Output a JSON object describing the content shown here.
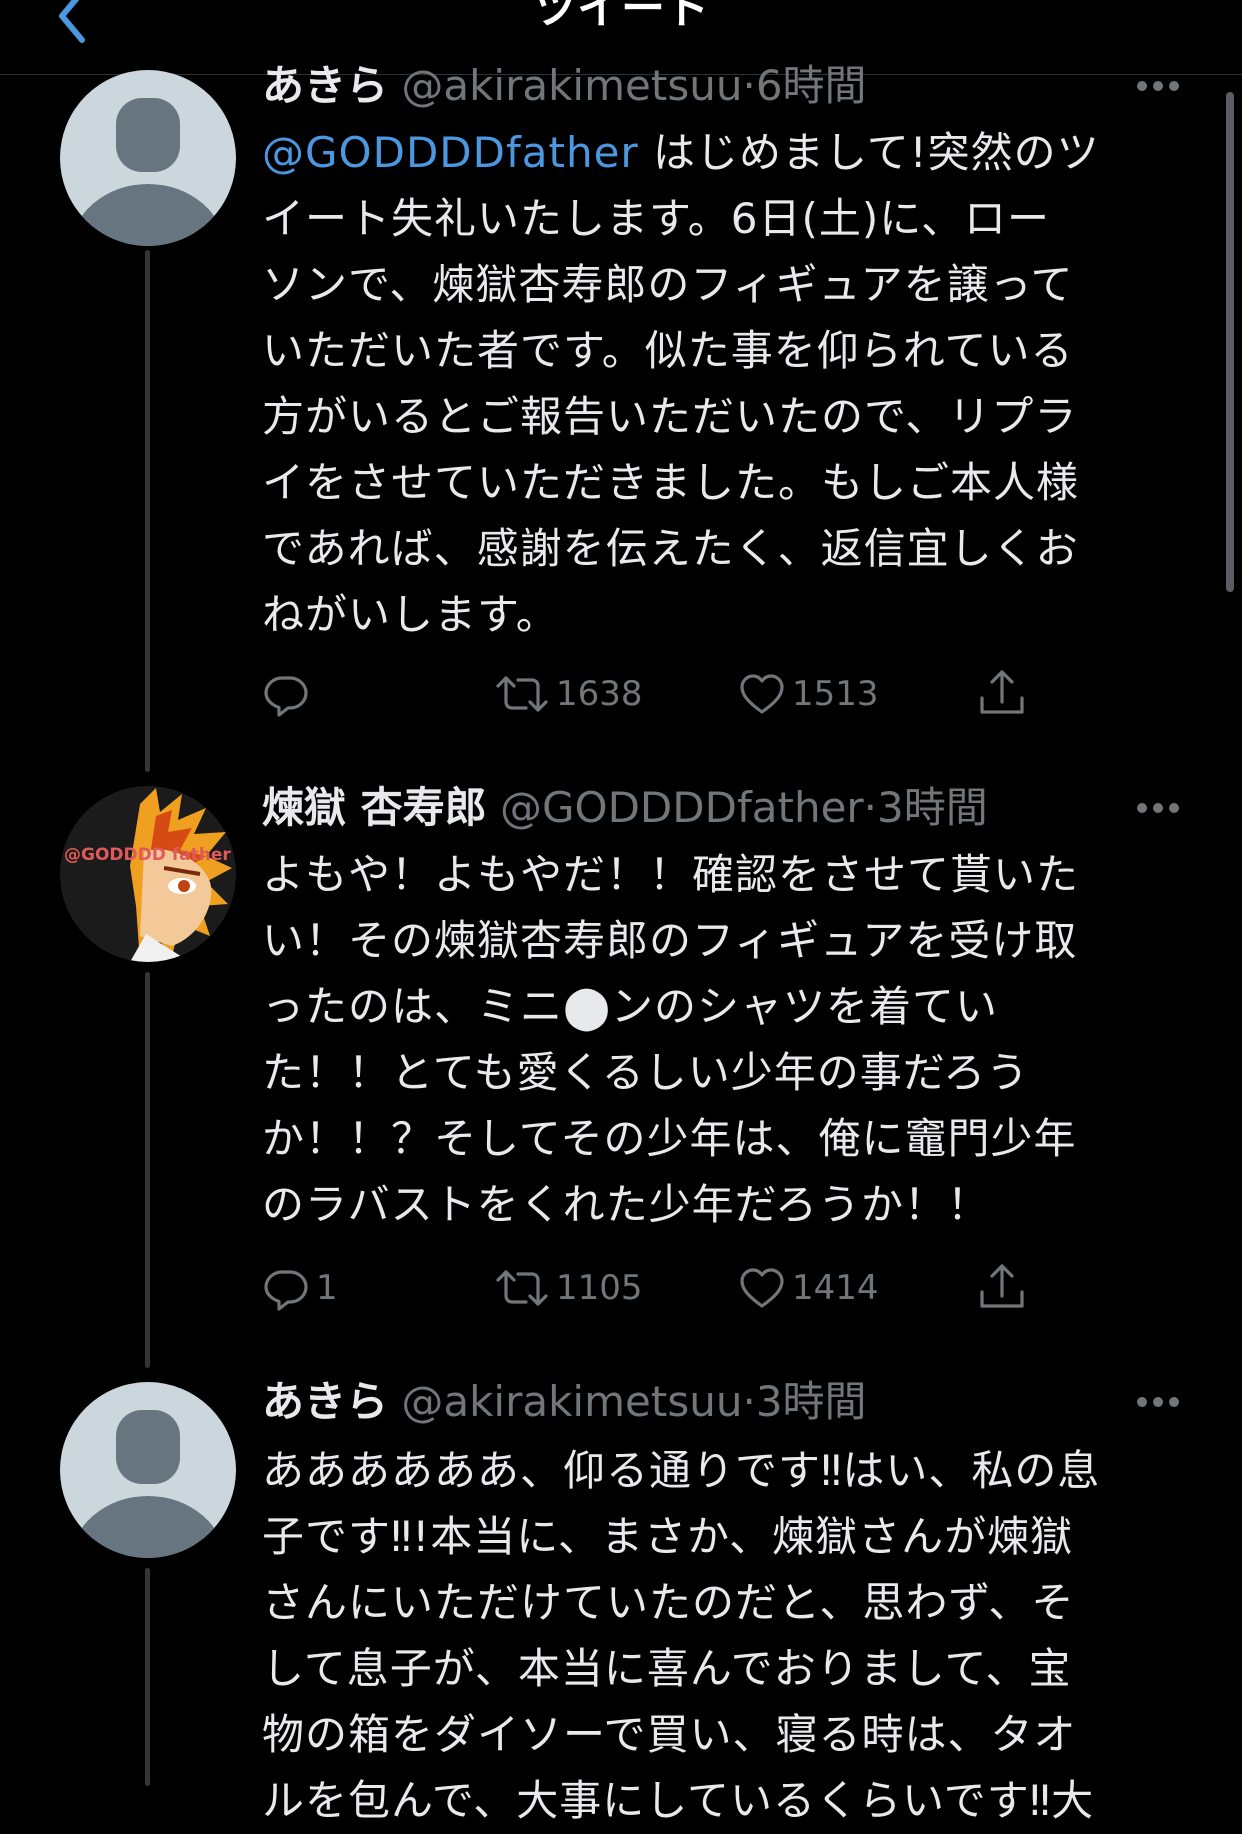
{
  "header": {
    "title": "ツイート",
    "back_icon": "chevron-left-icon"
  },
  "tweets": [
    {
      "name": "あきら",
      "handle": "@akirakimetsuu",
      "sep": "·",
      "time": "6時間",
      "mention": "@GODDDDfather",
      "lines": [
        " はじめまして!突然のツ",
        "イート失礼いたします。6日(土)に、ロー",
        "ソンで、煉獄杏寿郎のフィギュアを譲って",
        "いただいた者です。似た事を仰られている",
        "方がいるとご報告いただいたので、リプラ",
        "イをさせていただきました。もしご本人様",
        "であれば、感謝を伝えたく、返信宜しくお",
        "ねがいします。"
      ],
      "reply_count": "",
      "retweet_count": "1638",
      "like_count": "1513"
    },
    {
      "name": "煉獄 杏寿郎",
      "handle": "@GODDDDfather",
      "sep": "·",
      "time": "3時間",
      "avatar_text": "@GODDDD father",
      "lines": [
        "よもや！よもやだ！！確認をさせて貰いた",
        "い！その煉獄杏寿郎のフィギュアを受け取",
        "ったのは、ミニ⬤ンのシャツを着てい",
        "た！！とても愛くるしい少年の事だろう",
        "か！！？そしてその少年は、俺に竈門少年",
        "のラバストをくれた少年だろうか！！"
      ],
      "reply_count": "1",
      "retweet_count": "1105",
      "like_count": "1414"
    },
    {
      "name": "あきら",
      "handle": "@akirakimetsuu",
      "sep": "·",
      "time": "3時間",
      "lines": [
        "ああああああ、仰る通りです‼はい、私の息",
        "子です‼!本当に、まさか、煉獄さんが煉獄",
        "さんにいただけていたのだと、思わず、そ",
        "して息子が、本当に喜んでおりまして、宝",
        "物の箱をダイソーで買い、寝る時は、タオ",
        "ルを包んで、大事にしているくらいです‼大"
      ]
    }
  ],
  "icons": {
    "reply": "reply-icon",
    "retweet": "retweet-icon",
    "like": "heart-icon",
    "share": "share-icon",
    "more": "more-icon"
  },
  "colors": {
    "background": "#000000",
    "text": "#e7e9ea",
    "muted": "#71767b",
    "link": "#4b97e0"
  }
}
